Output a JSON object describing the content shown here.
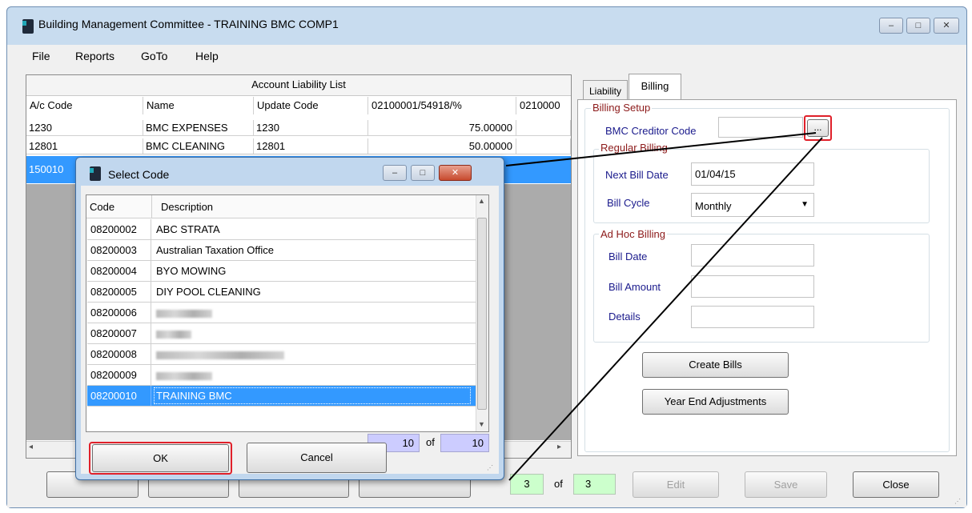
{
  "window": {
    "title": "Building Management Committee - TRAINING BMC COMP1",
    "controls": {
      "minimize": "–",
      "maximize": "□",
      "close": "✕"
    }
  },
  "menu": [
    "File",
    "Reports",
    "GoTo",
    "Help"
  ],
  "liability_list": {
    "title": "Account Liability List",
    "columns": [
      "A/c Code",
      "Name",
      "Update Code",
      "02100001/54918/%",
      "0210000"
    ],
    "rows": [
      [
        "1230",
        "BMC EXPENSES",
        "1230",
        "75.00000",
        ""
      ],
      [
        "12801",
        "BMC CLEANING",
        "12801",
        "50.00000",
        ""
      ],
      [
        "150010",
        "",
        "",
        "",
        ""
      ]
    ]
  },
  "tabs": {
    "liability": "Liability",
    "billing": "Billing"
  },
  "billing": {
    "setup_label": "Billing Setup",
    "creditor_label": "BMC Creditor Code",
    "creditor_value": "",
    "browse_btn": "...",
    "regular_label": "Regular Billing",
    "next_bill_label": "Next Bill Date",
    "next_bill_value": "01/04/15",
    "cycle_label": "Bill Cycle",
    "cycle_value": "Monthly",
    "adhoc_label": "Ad Hoc Billing",
    "bill_date_label": "Bill Date",
    "bill_amount_label": "Bill Amount",
    "details_label": "Details",
    "create_bills": "Create Bills",
    "year_end": "Year End Adjustments"
  },
  "bottom_bar": {
    "record_index": "3",
    "of_label": "of",
    "record_total": "3",
    "edit": "Edit",
    "save": "Save",
    "close": "Close"
  },
  "dialog": {
    "title": "Select Code",
    "columns": [
      "Code",
      "Description"
    ],
    "rows": [
      {
        "code": "08200002",
        "desc": "ABC STRATA",
        "redacted": false
      },
      {
        "code": "08200003",
        "desc": "Australian Taxation Office",
        "redacted": false
      },
      {
        "code": "08200004",
        "desc": "BYO MOWING",
        "redacted": false
      },
      {
        "code": "08200005",
        "desc": "DIY POOL CLEANING",
        "redacted": false
      },
      {
        "code": "08200006",
        "desc": "",
        "redacted": true
      },
      {
        "code": "08200007",
        "desc": "",
        "redacted": true
      },
      {
        "code": "08200008",
        "desc": "",
        "redacted": true
      },
      {
        "code": "08200009",
        "desc": "",
        "redacted": true
      },
      {
        "code": "08200010",
        "desc": "TRAINING BMC",
        "redacted": false
      }
    ],
    "selected_index": 8,
    "count_current": "10",
    "count_of": "of",
    "count_total": "10",
    "ok": "OK",
    "cancel": "Cancel"
  },
  "colors": {
    "selection": "#3399ff",
    "highlight_border": "#e0202a",
    "counter_bg": "#ccccff",
    "record_bg": "#ccffcc",
    "title_bg": "#c8dcef"
  }
}
